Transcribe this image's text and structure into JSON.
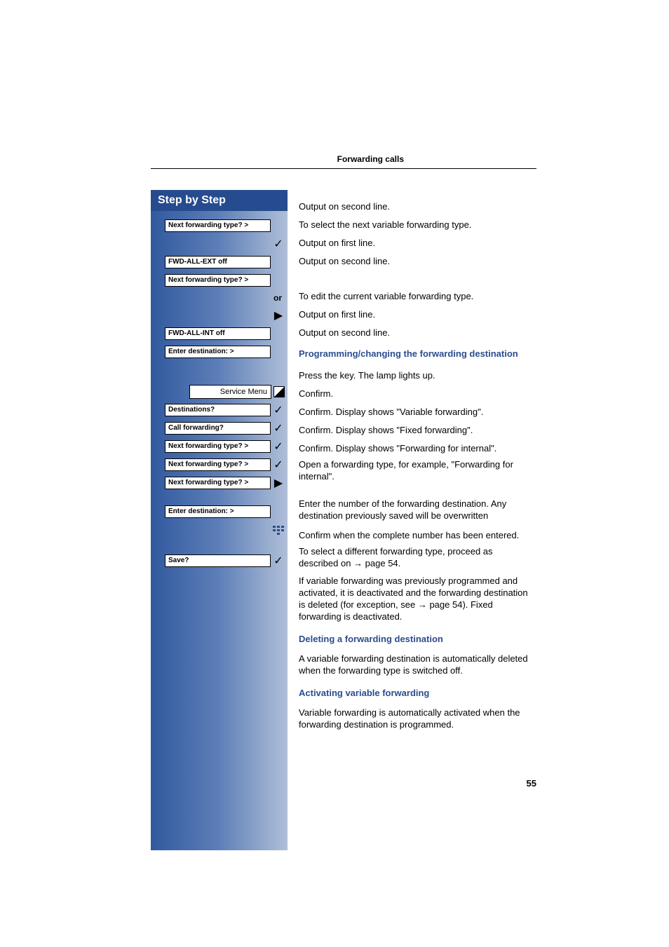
{
  "header": {
    "title": "Forwarding calls"
  },
  "sidebar": {
    "title": "Step by Step",
    "or_label": "or",
    "rows": [
      {
        "label": "Next forwarding type?  >"
      },
      {
        "label": "FWD-ALL-EXT off"
      },
      {
        "label": "Next forwarding type?  >"
      },
      {
        "label": "FWD-ALL-INT off"
      },
      {
        "label": "Enter destination:    >"
      },
      {
        "service_menu": "Service Menu"
      },
      {
        "label": "Destinations?"
      },
      {
        "label": "Call forwarding?"
      },
      {
        "label": "Next forwarding type?  >"
      },
      {
        "label": "Next forwarding type?  >"
      },
      {
        "label": "Next forwarding type?  >"
      },
      {
        "label": "Enter destination:    >"
      },
      {
        "label": "Save?"
      }
    ]
  },
  "right": {
    "lines": {
      "l1": "Output on second line.",
      "l2": "To select the next variable forwarding type.",
      "l3": "Output on first line.",
      "l4": "Output on second line.",
      "l5": "To edit the current variable forwarding type.",
      "l6": "Output on first line.",
      "l7": "Output on second line.",
      "h1": "Programming/changing the forwarding destination",
      "l8": "Press the key. The lamp lights up.",
      "l9": "Confirm.",
      "l10": "Confirm. Display shows \"Variable forwarding\".",
      "l11": "Confirm. Display shows \"Fixed forwarding\".",
      "l12": "Confirm. Display shows \"Forwarding for internal\".",
      "l13": "Open a forwarding type, for example, \"Forwarding for internal\".",
      "l14": "Enter the number of the forwarding destination. Any destination previously saved will be overwritten",
      "l15": "Confirm when the complete number has been entered.",
      "l16a": "To select a different forwarding type, proceed as described on ",
      "page_ref1": "→ page 54.",
      "l17a": "If variable forwarding was previously programmed and activated, it is deactivated and the forwarding destination is deleted (for exception, see ",
      "page_ref2": "→ page 54",
      "l17b": "). Fixed forwarding is deactivated.",
      "h2": "Deleting a forwarding destination",
      "l18": "A variable forwarding destination is automatically deleted when the forwarding type is switched off.",
      "h3": "Activating variable forwarding",
      "l19": "Variable forwarding is automatically activated when the forwarding destination is programmed."
    }
  },
  "page_number": "55"
}
